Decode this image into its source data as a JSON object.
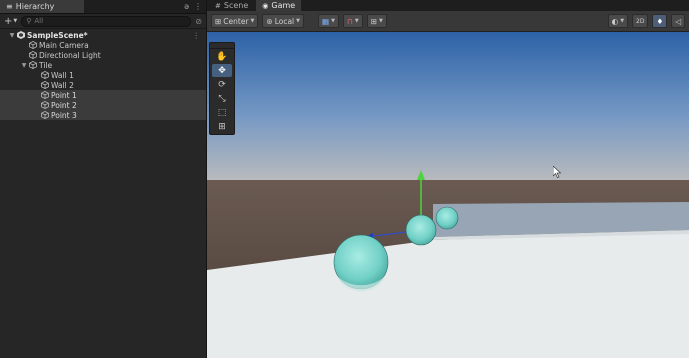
{
  "hierarchy": {
    "tab_label": "Hierarchy",
    "search_placeholder": "All",
    "items": [
      {
        "label": "SampleScene*",
        "depth": 0,
        "expanded": true,
        "icon": "unity-scene-icon",
        "bold": true
      },
      {
        "label": "Main Camera",
        "depth": 1,
        "icon": "gameobject-icon"
      },
      {
        "label": "Directional Light",
        "depth": 1,
        "icon": "gameobject-icon"
      },
      {
        "label": "Tile",
        "depth": 1,
        "expanded": true,
        "icon": "gameobject-icon"
      },
      {
        "label": "Wall 1",
        "depth": 2,
        "icon": "gameobject-icon"
      },
      {
        "label": "Wall 2",
        "depth": 2,
        "icon": "gameobject-icon"
      },
      {
        "label": "Point 1",
        "depth": 2,
        "icon": "gameobject-icon",
        "selected": true
      },
      {
        "label": "Point 2",
        "depth": 2,
        "icon": "gameobject-icon",
        "selected": true
      },
      {
        "label": "Point 3",
        "depth": 2,
        "icon": "gameobject-icon",
        "selected": true
      }
    ]
  },
  "scene_view": {
    "tabs": [
      {
        "label": "Scene",
        "icon": "grid-icon",
        "active": false
      },
      {
        "label": "Game",
        "icon": "gamepad-icon",
        "active": true
      }
    ],
    "toolbar": {
      "pivot_label": "Center",
      "space_label": "Local"
    },
    "tools": [
      "hand-tool-icon",
      "move-tool-icon",
      "rotate-tool-icon",
      "scale-tool-icon",
      "rect-tool-icon",
      "transform-tool-icon"
    ],
    "active_tool": "move-tool-icon"
  },
  "colors": {
    "sky_top": "#2f65a8",
    "sky_bottom": "#b4b6b9",
    "ground": "#5a4a42",
    "floor": "#e9eced",
    "sphere": "#7fd8cf",
    "gizmo_y": "#4fd33e",
    "gizmo_z": "#2a4bd6",
    "selection": "#3b3b3b"
  }
}
